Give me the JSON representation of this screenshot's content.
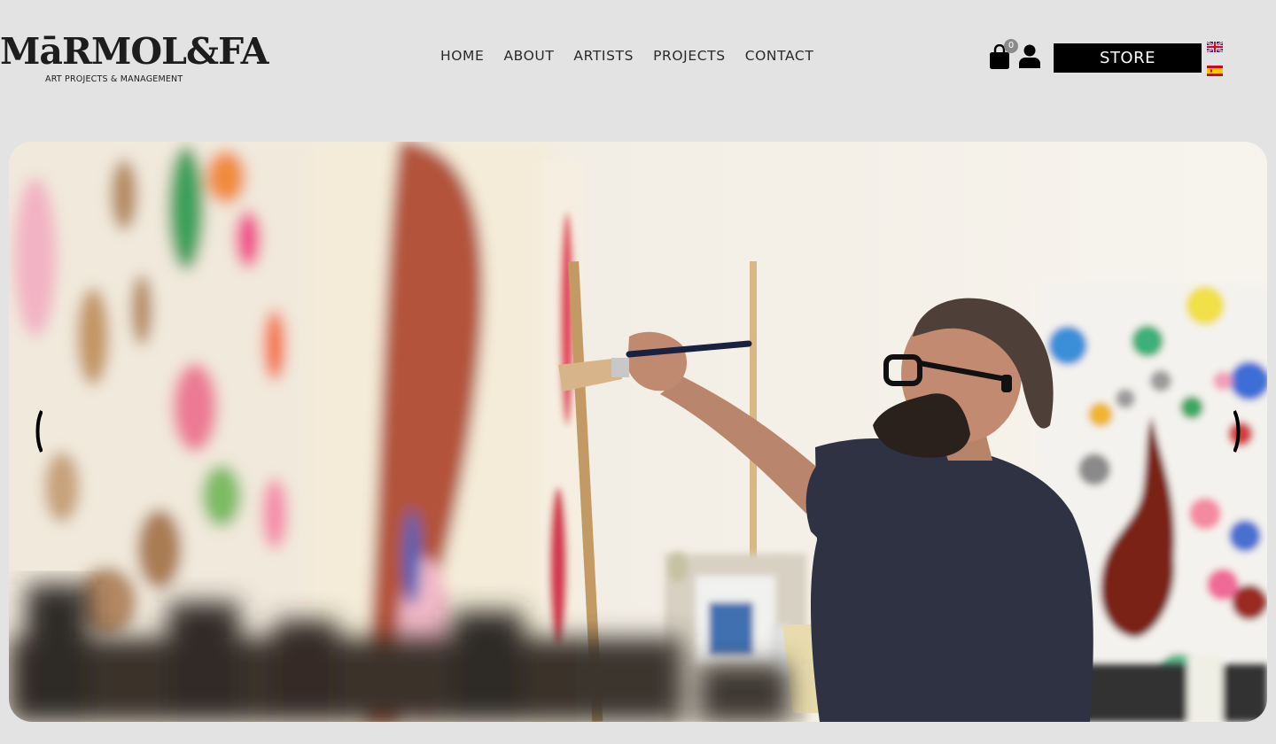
{
  "brand": {
    "logo_text": "MāRMOL&FA",
    "tagline": "ART PROJECTS & MANAGEMENT"
  },
  "nav": {
    "items": [
      "HOME",
      "ABOUT",
      "ARTISTS",
      "PROJECTS",
      "CONTACT"
    ]
  },
  "cart": {
    "count": "0"
  },
  "store_button": {
    "label": "STORE"
  },
  "languages": [
    "en",
    "es"
  ],
  "hero": {
    "image_description_icon": "hero-photo"
  },
  "colors": {
    "background": "#e3e3e3",
    "store_button": "#000000",
    "text": "#2a2a2a"
  }
}
